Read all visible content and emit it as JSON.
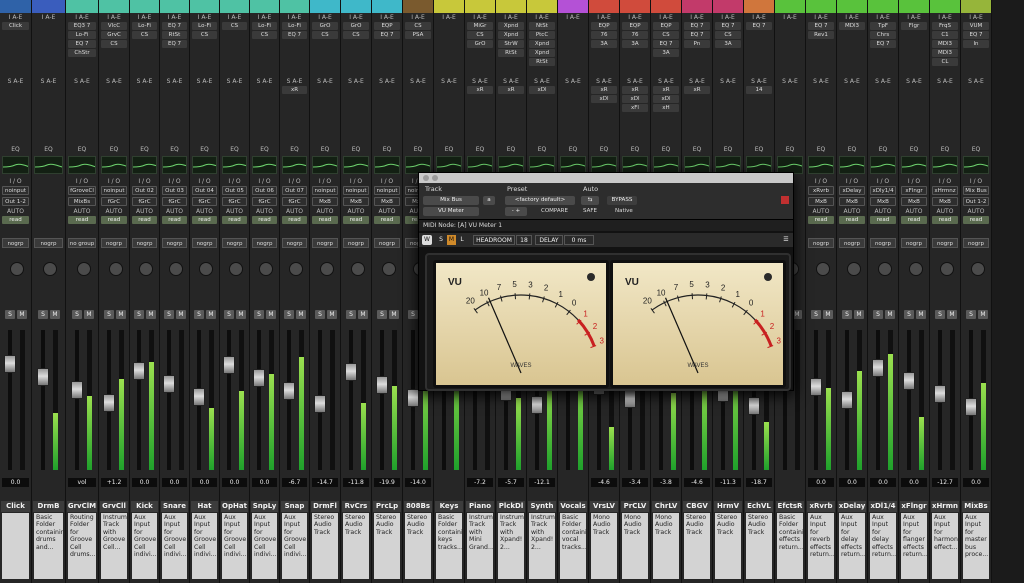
{
  "tracks": [
    {
      "name": "Click",
      "color": "#2f62a8",
      "inserts": [
        "Click"
      ],
      "sends": [],
      "io": [
        "noinput",
        "Out 1-2"
      ],
      "auto": "AUTO",
      "read": "read",
      "group": "nogrp",
      "vol": "0.0",
      "comment": "",
      "folder": ""
    },
    {
      "name": "DrmB",
      "color": "#3a5dbd",
      "inserts": [],
      "sends": [],
      "io": [],
      "auto": "",
      "read": "",
      "group": "nogrp",
      "vol": "",
      "comment": "Basic Folder containing drums and...",
      "folder": ""
    },
    {
      "name": "GrvClM",
      "color": "#4fc2a4",
      "inserts": [
        "EQ3 7",
        "Lo-Fi",
        "EQ 7",
        "ChStr"
      ],
      "sends": [],
      "io": [
        "fGroveCl",
        "MixBs"
      ],
      "auto": "AUTO",
      "read": "read",
      "group": "no group",
      "vol": "vol",
      "comment": "Routing Folder for Groove Cell drums...",
      "folder": "folder"
    },
    {
      "name": "GrvCll",
      "color": "#4fc2a4",
      "inserts": [
        "VlcC",
        "GrvC",
        "CS"
      ],
      "sends": [],
      "io": [
        "noinput",
        "fGrC"
      ],
      "auto": "AUTO",
      "read": "read",
      "group": "nogrp",
      "vol": "+1.2",
      "comment": "Instrument Track with Groove Cell...",
      "folder": ""
    },
    {
      "name": "Kick",
      "color": "#4fc2a4",
      "inserts": [
        "Lo-Fi",
        "CS"
      ],
      "sends": [],
      "io": [
        "Out 02",
        "fGrC"
      ],
      "auto": "AUTO",
      "read": "read",
      "group": "nogrp",
      "vol": "0.0",
      "comment": "Aux Input for Groove Cell indivi...",
      "folder": ""
    },
    {
      "name": "Snare",
      "color": "#4fc2a4",
      "inserts": [
        "EQ 7",
        "RtSt",
        "EQ 7"
      ],
      "sends": [],
      "io": [
        "Out 03",
        "fGrC"
      ],
      "auto": "AUTO",
      "read": "read",
      "group": "nogrp",
      "vol": "0.0",
      "comment": "Aux Input for Groove Cell indivi...",
      "folder": ""
    },
    {
      "name": "Hat",
      "color": "#4fc2a4",
      "inserts": [
        "Lo-Fi",
        "CS"
      ],
      "sends": [],
      "io": [
        "Out 04",
        "fGrC"
      ],
      "auto": "AUTO",
      "read": "read",
      "group": "nogrp",
      "vol": "0.0",
      "comment": "Aux Input for Groove Cell indivi...",
      "folder": ""
    },
    {
      "name": "OpHat",
      "color": "#4fc2a4",
      "inserts": [
        "CS"
      ],
      "sends": [],
      "io": [
        "Out 05",
        "fGrC"
      ],
      "auto": "AUTO",
      "read": "read",
      "group": "nogrp",
      "vol": "0.0",
      "comment": "Aux Input for Groove Cell indivi...",
      "folder": ""
    },
    {
      "name": "SnpLy",
      "color": "#4fc2a4",
      "inserts": [
        "Lo-Fi",
        "CS"
      ],
      "sends": [],
      "io": [
        "Out 06",
        "fGrC"
      ],
      "auto": "AUTO",
      "read": "read",
      "group": "nogrp",
      "vol": "0.0",
      "comment": "Aux Input for Groove Cell indivi...",
      "folder": ""
    },
    {
      "name": "Snap",
      "color": "#4fc2a4",
      "inserts": [
        "Lo-Fi",
        "EQ 7"
      ],
      "sends": [
        "xR"
      ],
      "io": [
        "Out 07",
        "fGrC"
      ],
      "auto": "AUTO",
      "read": "read",
      "group": "nogrp",
      "vol": "-6.7",
      "comment": "Aux Input for Groove Cell indivi...",
      "folder": ""
    },
    {
      "name": "DrmFl",
      "color": "#3fb8c9",
      "inserts": [
        "GrO",
        "CS"
      ],
      "sends": [],
      "io": [
        "noinput",
        "MxB"
      ],
      "auto": "AUTO",
      "read": "read",
      "group": "nogrp",
      "vol": "-14.7",
      "comment": "Stereo Audio Track",
      "folder": ""
    },
    {
      "name": "RvCrs",
      "color": "#3fb8c9",
      "inserts": [
        "GrO",
        "CS"
      ],
      "sends": [],
      "io": [
        "noinput",
        "MxB"
      ],
      "auto": "AUTO",
      "read": "read",
      "group": "nogrp",
      "vol": "-11.8",
      "comment": "Stereo Audio Track",
      "folder": ""
    },
    {
      "name": "PrcLp",
      "color": "#3fb8c9",
      "inserts": [
        "EQP",
        "EQ 7"
      ],
      "sends": [],
      "io": [
        "noinput",
        "MxB"
      ],
      "auto": "AUTO",
      "read": "read",
      "group": "nogrp",
      "vol": "-19.9",
      "comment": "Stereo Audio Track",
      "folder": ""
    },
    {
      "name": "808Bs",
      "color": "#7a5a2e",
      "inserts": [
        "CS",
        "PSA"
      ],
      "sends": [],
      "io": [
        "noinput",
        "MxB"
      ],
      "auto": "AUTO",
      "read": "read",
      "group": "nogrp",
      "vol": "-14.0",
      "comment": "Stereo Audio Track",
      "folder": ""
    },
    {
      "name": "Keys",
      "color": "#c8c83a",
      "inserts": [],
      "sends": [],
      "io": [],
      "auto": "",
      "read": "",
      "group": "",
      "vol": "",
      "comment": "Basic Folder containing keys tracks...",
      "folder": ""
    },
    {
      "name": "Piano",
      "color": "#c8c83a",
      "inserts": [
        "MiGr",
        "CS",
        "GrO"
      ],
      "sends": [
        "xR"
      ],
      "io": [],
      "auto": "",
      "read": "",
      "group": "",
      "vol": "-7.2",
      "comment": "Instrument Track with Mini Grand...",
      "folder": ""
    },
    {
      "name": "PlckDl",
      "color": "#c8c83a",
      "inserts": [
        "Xpnd",
        "Xpnd",
        "StrW",
        "RtSt"
      ],
      "sends": [
        "xR"
      ],
      "io": [],
      "auto": "",
      "read": "",
      "group": "",
      "vol": "-5.7",
      "comment": "Instrument Track with Xpand! 2...",
      "folder": ""
    },
    {
      "name": "Synth",
      "color": "#c8c83a",
      "inserts": [
        "NtSt",
        "PtcC",
        "Xpnd",
        "Xpnd",
        "RtSt"
      ],
      "sends": [
        "xDl"
      ],
      "io": [],
      "auto": "",
      "read": "",
      "group": "",
      "vol": "-12.1",
      "comment": "Instrument Track with Xpand! 2...",
      "folder": ""
    },
    {
      "name": "Vocals",
      "color": "#b451d6",
      "inserts": [],
      "sends": [],
      "io": [],
      "auto": "",
      "read": "",
      "group": "",
      "vol": "",
      "comment": "Basic Folder containing vocal tracks...",
      "folder": ""
    },
    {
      "name": "VrsLV",
      "color": "#d04b3c",
      "inserts": [
        "EQP",
        "76",
        "3A"
      ],
      "sends": [
        "xR",
        "xDl"
      ],
      "io": [],
      "auto": "",
      "read": "",
      "group": "",
      "vol": "-4.6",
      "comment": "Mono Audio Track",
      "folder": ""
    },
    {
      "name": "PrCLV",
      "color": "#d04b3c",
      "inserts": [
        "EQP",
        "76",
        "3A"
      ],
      "sends": [
        "xR",
        "xDl",
        "xFl"
      ],
      "io": [],
      "auto": "",
      "read": "",
      "group": "",
      "vol": "-3.4",
      "comment": "Mono Audio Track",
      "folder": ""
    },
    {
      "name": "ChrLV",
      "color": "#d04b3c",
      "inserts": [
        "EQP",
        "CS",
        "EQ 7",
        "3A"
      ],
      "sends": [
        "xR",
        "xDl",
        "xH"
      ],
      "io": [],
      "auto": "",
      "read": "",
      "group": "",
      "vol": "-3.8",
      "comment": "Mono Audio Track",
      "folder": ""
    },
    {
      "name": "CBGV",
      "color": "#c23a6a",
      "inserts": [
        "EQ 7",
        "EQ 7",
        "Pn"
      ],
      "sends": [
        "xR"
      ],
      "io": [],
      "auto": "",
      "read": "",
      "group": "",
      "vol": "-4.6",
      "comment": "Stereo Audio Track",
      "folder": ""
    },
    {
      "name": "HrmV",
      "color": "#c23a6a",
      "inserts": [
        "EQ 7",
        "CS",
        "3A"
      ],
      "sends": [],
      "io": [],
      "auto": "",
      "read": "",
      "group": "",
      "vol": "-11.3",
      "comment": "Stereo Audio Track",
      "folder": ""
    },
    {
      "name": "EchVL",
      "color": "#d0763c",
      "inserts": [
        "EQ 7"
      ],
      "sends": [
        "14"
      ],
      "io": [],
      "auto": "",
      "read": "",
      "group": "",
      "vol": "-18.7",
      "comment": "Stereo Audio Track",
      "folder": ""
    },
    {
      "name": "EfctsR",
      "color": "#59c23c",
      "inserts": [],
      "sends": [],
      "io": [],
      "auto": "",
      "read": "",
      "group": "",
      "vol": "",
      "comment": "Basic Folder containing effects return...",
      "folder": ""
    },
    {
      "name": "xRvrb",
      "color": "#59c23c",
      "inserts": [
        "EQ 7",
        "Rev1"
      ],
      "sends": [],
      "io": [
        "xRvrb",
        "MxB"
      ],
      "auto": "AUTO",
      "read": "read",
      "group": "nogrp",
      "vol": "0.0",
      "comment": "Aux Input for reverb effects return...",
      "folder": ""
    },
    {
      "name": "xDelay",
      "color": "#59c23c",
      "inserts": [
        "MDl3"
      ],
      "sends": [],
      "io": [
        "xDelay",
        "MxB"
      ],
      "auto": "AUTO",
      "read": "read",
      "group": "nogrp",
      "vol": "0.0",
      "comment": "Aux Input for delay effects return...",
      "folder": ""
    },
    {
      "name": "xDl1/4",
      "color": "#59c23c",
      "inserts": [
        "TpF",
        "Chrs",
        "EQ 7"
      ],
      "sends": [],
      "io": [
        "xDly1/4",
        "MxB"
      ],
      "auto": "AUTO",
      "read": "read",
      "group": "nogrp",
      "vol": "0.0",
      "comment": "Aux Input for delay effects return...",
      "folder": ""
    },
    {
      "name": "xFlngr",
      "color": "#59c23c",
      "inserts": [
        "Flgr"
      ],
      "sends": [],
      "io": [
        "xFlngr",
        "MxB"
      ],
      "auto": "AUTO",
      "read": "read",
      "group": "nogrp",
      "vol": "0.0",
      "comment": "Aux Input for flanger effects return...",
      "folder": ""
    },
    {
      "name": "xHrmn",
      "color": "#59c23c",
      "inserts": [
        "FrqS",
        "C1",
        "MDl3",
        "MDl3",
        "CL"
      ],
      "sends": [],
      "io": [
        "xHrmnz",
        "MxB"
      ],
      "auto": "AUTO",
      "read": "read",
      "group": "nogrp",
      "vol": "-12.7",
      "comment": "Aux Input for harmonizer effect...",
      "folder": ""
    },
    {
      "name": "MixBs",
      "color": "#96b53a",
      "inserts": [
        "VUM",
        "EQ 7",
        "In"
      ],
      "sends": [],
      "io": [
        "Mix Bus",
        "Out 1-2"
      ],
      "auto": "AUTO",
      "read": "read",
      "group": "nogrp",
      "vol": "0.0",
      "comment": "Aux Input for master bus proce...",
      "folder": ""
    }
  ],
  "labels": {
    "inserts": "I A-E",
    "sends": "S A-E",
    "eq": "EQ",
    "io": "I / O",
    "auto": "AUTO"
  },
  "plugin": {
    "track_label": "Track",
    "preset_label": "Preset",
    "auto_label": "Auto",
    "track_name": "Mix Bus",
    "track_suffix": "a",
    "plugin_name": "VU Meter",
    "preset_name": "<factory default>",
    "compare": "COMPARE",
    "bypass": "BYPASS",
    "safe": "SAFE",
    "native": "Native",
    "midi_node": "MIDI Node: [A] VU Meter 1",
    "toolbar": {
      "s": "S",
      "m": "M",
      "l": "L",
      "headroom": "HEADROOM",
      "headroom_val": "18",
      "delay": "DELAY",
      "delay_val": "0 ms"
    },
    "vu": {
      "label": "VU",
      "scale": [
        "20",
        "10",
        "7",
        "5",
        "3",
        "2",
        "1",
        "0",
        "1",
        "2",
        "3"
      ],
      "brand": "WAVES",
      "needle_left": 0.12,
      "needle_right": 0.12
    }
  }
}
